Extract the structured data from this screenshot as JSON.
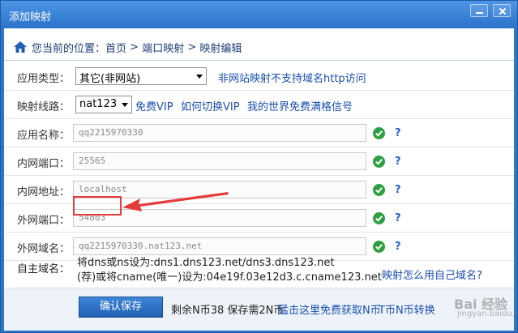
{
  "window": {
    "title": "添加映射"
  },
  "breadcrumb": {
    "prefix": "您当前的位置：",
    "items": [
      "首页",
      "端口映射",
      "映射编辑"
    ],
    "separator": " > "
  },
  "form": {
    "app_type": {
      "label": "应用类型：",
      "value": "其它(非网站)",
      "note": "非网站映射不支持域名http访问"
    },
    "route": {
      "label": "映射线路：",
      "value": "nat123",
      "links": [
        "免费VIP",
        "如何切换VIP",
        "我的世界免费满格信号"
      ]
    },
    "app_name": {
      "label": "应用名称：",
      "value": "qq2215970330"
    },
    "lan_port": {
      "label": "内网端口：",
      "value": "25565"
    },
    "lan_addr": {
      "label": "内网地址：",
      "value": "localhost"
    },
    "wan_port": {
      "label": "外网端口：",
      "value": "54803"
    },
    "wan_domain": {
      "label": "外网域名：",
      "value": "qq2215970330.nat123.net"
    },
    "help_mark": "?",
    "own_domain": {
      "label": "自主域名：",
      "line1": "将dns或ns设为:dns1.dns123.net/dns3.dns123.net",
      "line2": "(荐)或将cname(唯一)设为:04e19f.03e12d3.c.cname123.net",
      "link": "映射怎么用自己域名?"
    }
  },
  "footer": {
    "save_label": "确认保存",
    "info": "剩余N币38 保存需2N币",
    "links": [
      "猛击这里免费获取N币",
      "T币N币转换"
    ]
  },
  "watermark": {
    "brand": "Bai 经验",
    "url": "jingyan.baidu.com"
  },
  "colors": {
    "titlebar": "#2f76c8",
    "link": "#1a4fb0",
    "highlight": "#e53b3b",
    "check": "#2ea043"
  }
}
